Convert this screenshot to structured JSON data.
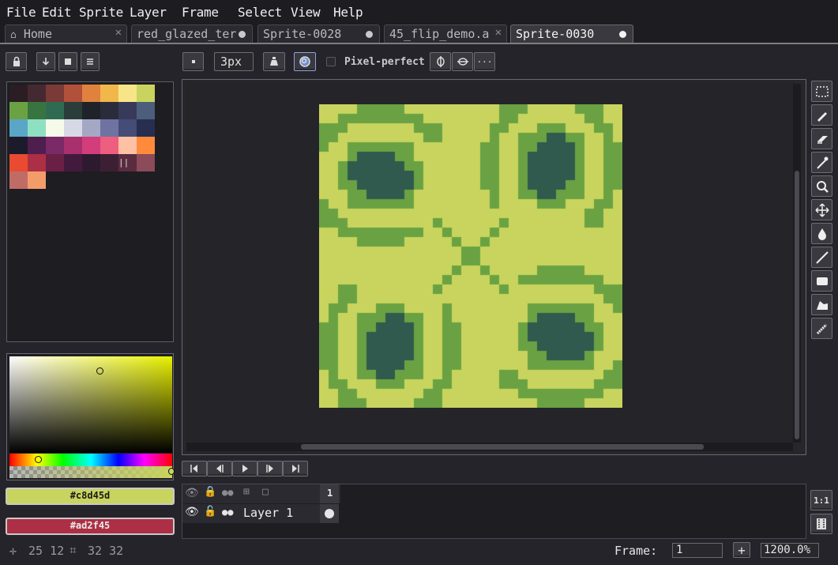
{
  "menu": [
    "File",
    "Edit",
    "Sprite",
    "Layer",
    "Frame",
    "Select",
    "View",
    "Help"
  ],
  "tabs": [
    {
      "label": "Home",
      "state": "close"
    },
    {
      "label": "red_glazed_ter",
      "state": "dot"
    },
    {
      "label": "Sprite-0028",
      "state": "dot"
    },
    {
      "label": "45_flip_demo.a",
      "state": "close"
    },
    {
      "label": "Sprite-0030",
      "state": "dot",
      "active": true
    }
  ],
  "toolbar": {
    "brush_size": "3px",
    "pixel_perfect_label": "Pixel-perfect",
    "more_label": "···"
  },
  "palette_colors": [
    "#2a1d24",
    "#452930",
    "#7a3a38",
    "#b1513b",
    "#e0823e",
    "#f2b74a",
    "#f8e58a",
    "#c8d45d",
    "#6aa243",
    "#37743f",
    "#2f6b52",
    "#2a3d3a",
    "#1f2229",
    "#2a2c3b",
    "#373a59",
    "#4d5e7d",
    "#5aa6c6",
    "#8ee0c3",
    "#f6fbe9",
    "#d6d9e5",
    "#a4a8c5",
    "#6f73a1",
    "#454c77",
    "#282e4f",
    "#1b1b2b",
    "#4e1e4e",
    "#7a2a66",
    "#a8306c",
    "#d33d7b",
    "#ee5e7e",
    "#ffc1a3",
    "#ff8a3b",
    "#e84a32",
    "#ad2f45",
    "#6a1f45",
    "#431a3d",
    "#2d1a2f",
    "#3d1f33",
    "#5a2c3f",
    "#8b4b5a",
    "#c06c66",
    "#f39c6a"
  ],
  "foreground_color": {
    "hex": "#c8d45d",
    "label": "#c8d45d"
  },
  "background_color": {
    "hex": "#ad2f45",
    "label": "#ad2f45"
  },
  "timeline": {
    "layer_name": "Layer 1",
    "frame_number": "1"
  },
  "status": {
    "cursor": "25 12",
    "size": "32 32",
    "frame_label": "Frame:",
    "frame_value": "1",
    "zoom": "1200.0%"
  },
  "sprite": {
    "width": 32,
    "height": 32,
    "colors": {
      "light": "#c8d45d",
      "mid": "#6aa243",
      "dark": "#2f5a4d"
    }
  }
}
